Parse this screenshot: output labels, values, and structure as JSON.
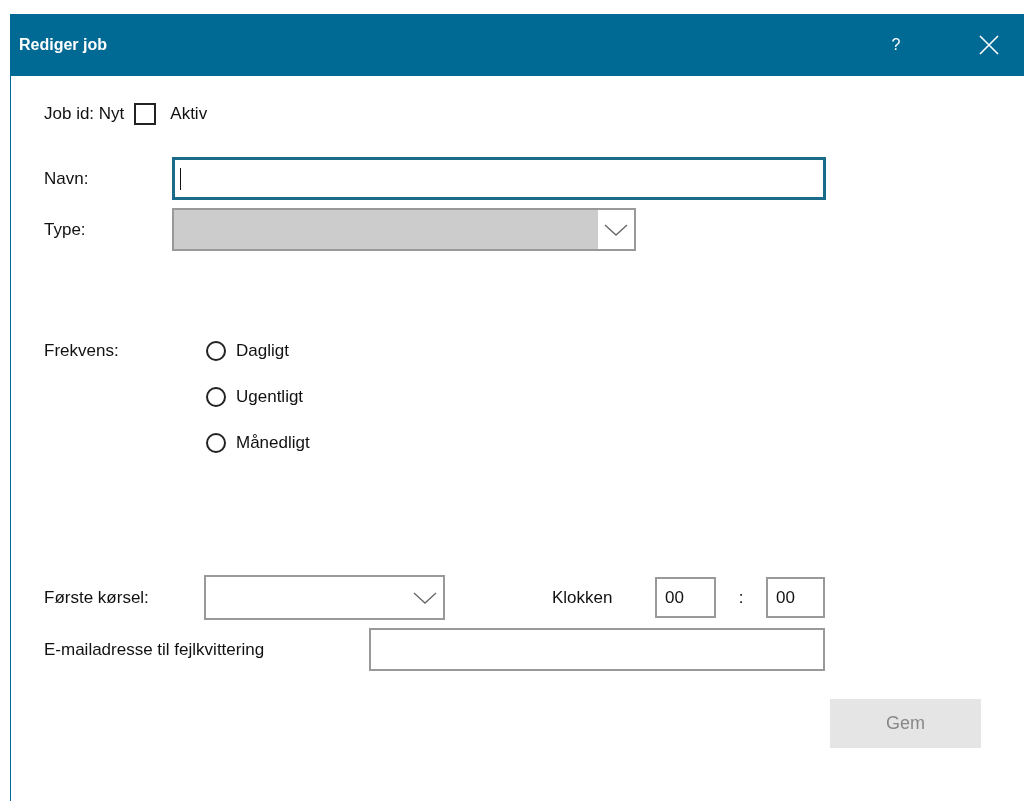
{
  "window": {
    "title": "Rediger job",
    "help": "?"
  },
  "job_id": "Job id: Nyt",
  "active": {
    "label": "Aktiv",
    "checked": false
  },
  "fields": [
    {
      "label": "Navn:",
      "kind": "text",
      "focused": true
    },
    {
      "label": "Type:",
      "kind": "select",
      "disabled": true
    }
  ],
  "frequency": {
    "label": "Frekvens:",
    "options": [
      {
        "label": "Dagligt",
        "selected": false
      },
      {
        "label": "Ugentligt",
        "selected": false
      },
      {
        "label": "Månedligt",
        "selected": false
      }
    ]
  },
  "first_run": {
    "label": "Første kørsel:"
  },
  "time": {
    "label": "Klokken",
    "hours": "00",
    "separator": ":",
    "minutes": "00"
  },
  "email": {
    "label": "E-mailadresse til fejlkvittering"
  },
  "save_button": {
    "label": "Gem",
    "disabled": true
  }
}
